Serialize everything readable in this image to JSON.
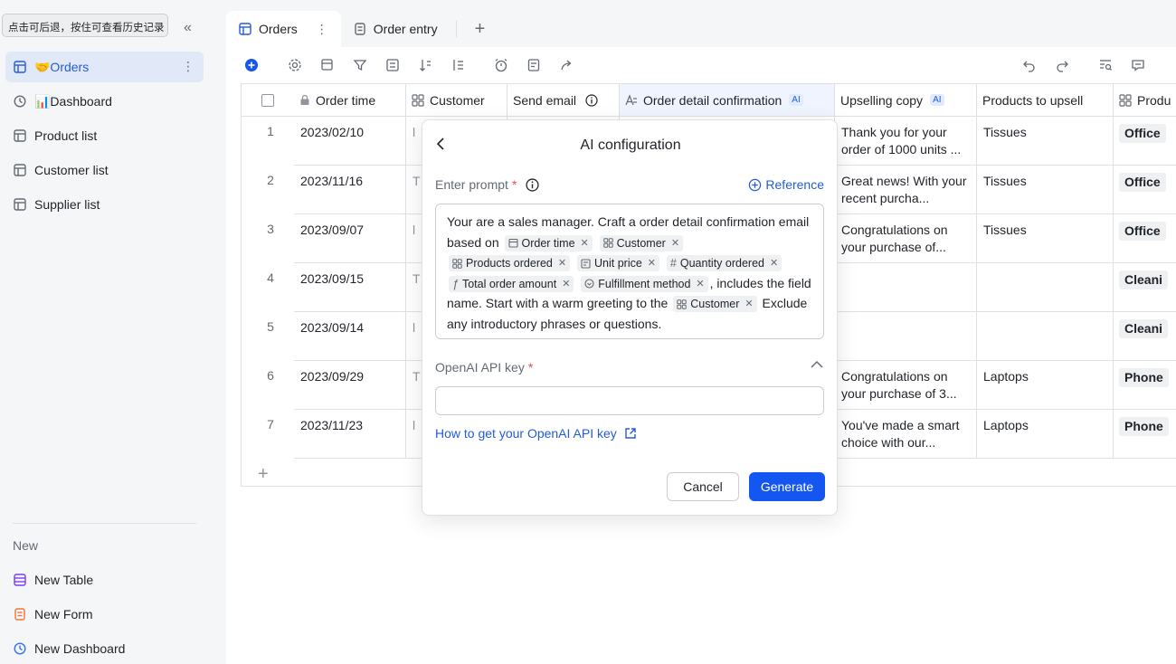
{
  "sidebar": {
    "tooltip": "点击可后退，按住可查看历史记录",
    "items": [
      {
        "label": "🤝Orders"
      },
      {
        "label": "📊Dashboard"
      },
      {
        "label": "Product list"
      },
      {
        "label": "Customer list"
      },
      {
        "label": "Supplier list"
      }
    ],
    "new_section": "New",
    "new_items": [
      {
        "label": "New Table"
      },
      {
        "label": "New Form"
      },
      {
        "label": "New Dashboard"
      }
    ]
  },
  "tabs": [
    {
      "label": "Orders"
    },
    {
      "label": "Order entry"
    }
  ],
  "grid": {
    "headers": {
      "order_time": "Order time",
      "customer": "Customer",
      "send_email": "Send email",
      "order_detail": "Order detail confirmation",
      "upselling": "Upselling copy",
      "products_upsell": "Products to upsell",
      "produ": "Produ",
      "ai": "AI"
    },
    "rows": [
      {
        "num": "1",
        "time": "2023/02/10",
        "cust": "l",
        "upsell": "Thank you for your order of 1000 units ...",
        "product": "Tissues",
        "cat": "Office"
      },
      {
        "num": "2",
        "time": "2023/11/16",
        "cust": "T",
        "upsell": "Great news! With your recent purcha...",
        "product": "Tissues",
        "cat": "Office"
      },
      {
        "num": "3",
        "time": "2023/09/07",
        "cust": "l",
        "upsell": "Congratulations on your purchase of...",
        "product": "Tissues",
        "cat": "Office"
      },
      {
        "num": "4",
        "time": "2023/09/15",
        "cust": "T",
        "upsell": "",
        "product": "",
        "cat": "Cleani"
      },
      {
        "num": "5",
        "time": "2023/09/14",
        "cust": "l",
        "upsell": "",
        "product": "",
        "cat": "Cleani"
      },
      {
        "num": "6",
        "time": "2023/09/29",
        "cust": "T",
        "upsell": "Congratulations on your purchase of 3...",
        "product": "Laptops",
        "cat": "Phone"
      },
      {
        "num": "7",
        "time": "2023/11/23",
        "cust": "l",
        "upsell": "You've made a smart choice with our...",
        "product": "Laptops",
        "cat": "Phone"
      }
    ]
  },
  "dialog": {
    "title": "AI configuration",
    "prompt_label": "Enter prompt",
    "required_mark": "*",
    "reference": "Reference",
    "prompt": {
      "t1": "Your are a sales manager. Craft a order detail confirmation email based on",
      "t2": ", includes the field name. Start with a warm greeting to the",
      "t3": "Exclude any introductory phrases or questions.",
      "tags": {
        "order_time": "Order time",
        "customer": "Customer",
        "products_ordered": "Products ordered",
        "unit_price": "Unit price",
        "quantity_ordered": "Quantity ordered",
        "total_order_amount": "Total order amount",
        "fulfillment_method": "Fulfillment method",
        "customer2": "Customer"
      }
    },
    "api_label": "OpenAI API key",
    "api_value": "",
    "how_link": "How to get your OpenAI API key",
    "cancel": "Cancel",
    "generate": "Generate"
  },
  "colors": {
    "accent": "#1456f0",
    "active_nav_bg": "#e1e8f7",
    "link": "#245bdb"
  }
}
